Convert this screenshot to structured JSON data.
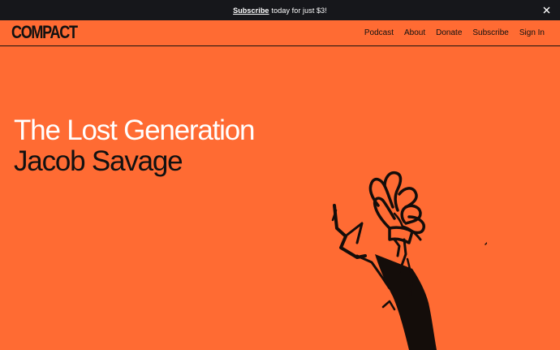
{
  "promo": {
    "link_text": "Subscribe",
    "rest_text": "today for just $3!",
    "close_icon": "close-icon"
  },
  "header": {
    "logo_text": "COMPACT",
    "nav": [
      {
        "label": "Podcast"
      },
      {
        "label": "About"
      },
      {
        "label": "Donate"
      },
      {
        "label": "Subscribe"
      },
      {
        "label": "Sign In"
      }
    ]
  },
  "hero": {
    "title": "The Lost Generation",
    "author": "Jacob Savage",
    "illustration_icon": "raised-hand-illustration"
  },
  "colors": {
    "background": "#ff6b33",
    "promo_bar": "#16171b",
    "title_text": "#ffffff",
    "dark_text": "#111111"
  }
}
